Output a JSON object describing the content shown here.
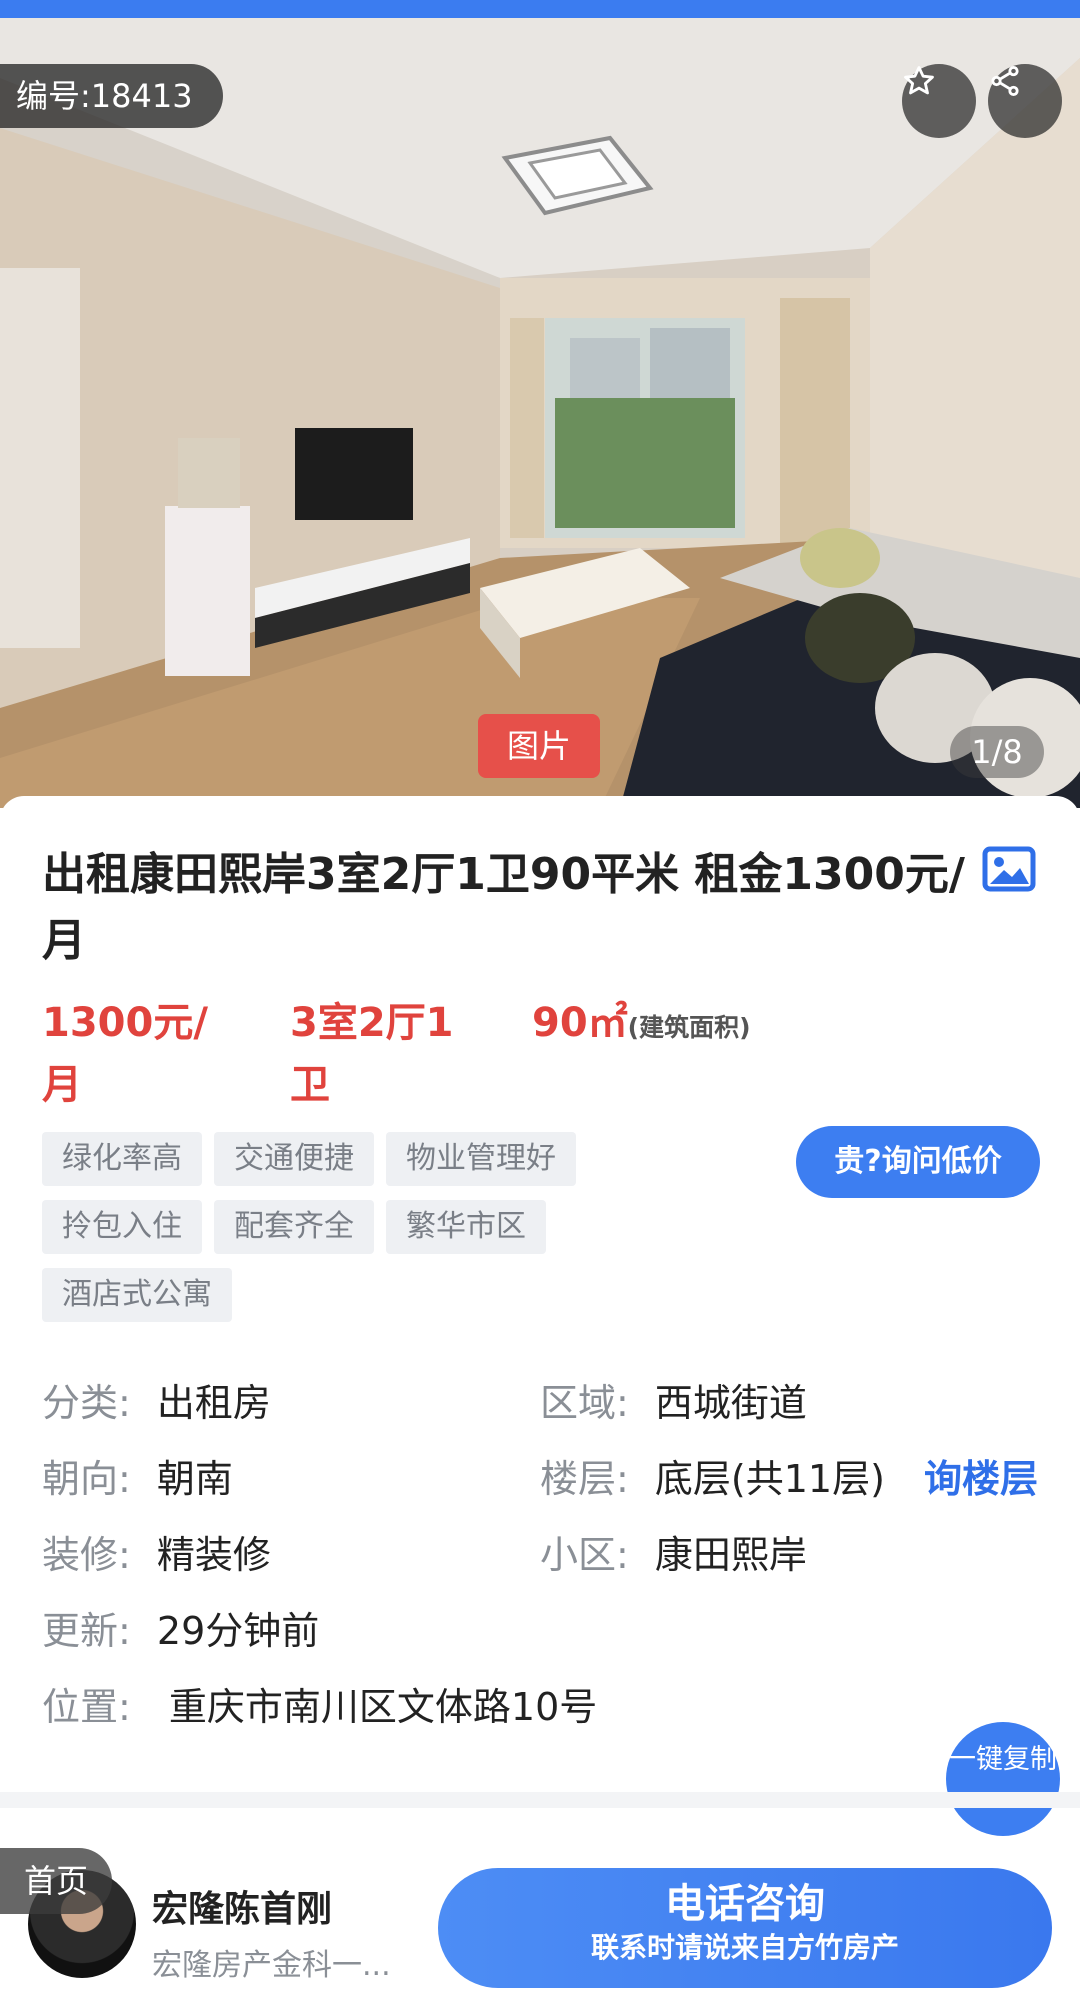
{
  "hero": {
    "listing_id": "编号:18413",
    "photo_tag": "图片",
    "photo_counter": "1/8",
    "fav_icon": "star-outline-icon",
    "share_icon": "share-icon"
  },
  "listing": {
    "title": "出租康田熙岸3室2厅1卫90平米 租金1300元/月",
    "title_icon": "image-icon",
    "price": "1300元/月",
    "rooms": "3室2厅1卫",
    "area": "90㎡",
    "area_note": "(建筑面积)",
    "tags": [
      "绿化率高",
      "交通便捷",
      "物业管理好",
      "拎包入住",
      "配套齐全",
      "繁华市区",
      "酒店式公寓"
    ],
    "ask_price_button": "贵?询问低价"
  },
  "details": {
    "category_label": "分类:",
    "category_value": "出租房",
    "district_label": "区域:",
    "district_value": "西城街道",
    "orientation_label": "朝向:",
    "orientation_value": "朝南",
    "floor_label": "楼层:",
    "floor_value": "底层(共11层)",
    "ask_floor_link": "询楼层",
    "decoration_label": "装修:",
    "decoration_value": "精装修",
    "community_label": "小区:",
    "community_value": "康田熙岸",
    "updated_label": "更新:",
    "updated_value": "29分钟前",
    "location_label": "位置:",
    "location_value": "重庆市南川区文体路10号",
    "copy_button": "一键复制"
  },
  "bottom_bar": {
    "home_tab": "首页",
    "agent_name": "宏隆陈首刚",
    "agent_company": "宏隆房产金科一...",
    "call_button": "电话咨询",
    "call_note": "联系时请说来自方竹房产"
  },
  "colors": {
    "accent_blue": "#3d7ef1",
    "price_red": "#e0433d",
    "tag_bg": "#eef0f3"
  }
}
